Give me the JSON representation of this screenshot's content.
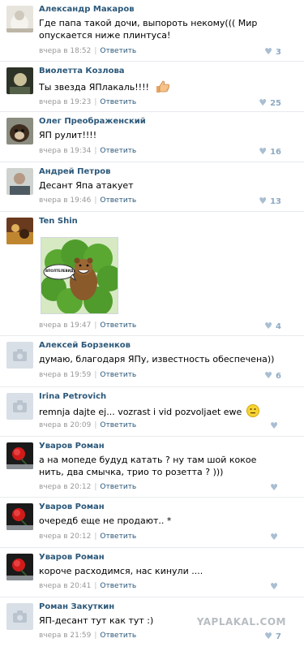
{
  "comments": [
    {
      "author": "Александр Макаров",
      "text": "Где папа такой дочи, выпороть некому((( Мир опускается ниже плинтуса!",
      "time": "вчера в 18:52",
      "reply": "Ответить",
      "likes": "3"
    },
    {
      "author": "Виолетта Козлова",
      "text": "Ты звезда ЯПлакаль!!!!",
      "time": "вчера в 19:23",
      "reply": "Ответить",
      "likes": "25"
    },
    {
      "author": "Олег Преображенский",
      "text": "ЯП рулит!!!!",
      "time": "вчера в 19:34",
      "reply": "Ответить",
      "likes": "16"
    },
    {
      "author": "Андрей Петров",
      "text": "Десант Япа атакует",
      "time": "вчера в 19:46",
      "reply": "Ответить",
      "likes": "13"
    },
    {
      "author": "Ten Shin",
      "text": "",
      "time": "вчера в 19:47",
      "reply": "Ответить",
      "likes": "4"
    },
    {
      "author": "Алексей Борзенков",
      "text": "думаю, благодаря ЯПу, известность обеспечена))",
      "time": "вчера в 19:59",
      "reply": "Ответить",
      "likes": "6"
    },
    {
      "author": "Irina Petrovich",
      "text": "remnja dajte ej... vozrast i vid pozvoljaet ewe",
      "time": "вчера в 20:09",
      "reply": "Ответить",
      "likes": ""
    },
    {
      "author": "Уваров Роман",
      "text": "а на мопеде будуд катать ? ну там шой кокое нить, два смычка, трио то розетта ? )))",
      "time": "вчера в 20:12",
      "reply": "Ответить",
      "likes": ""
    },
    {
      "author": "Уваров Роман",
      "text": "очередб еще не продают.. *",
      "time": "вчера в 20:12",
      "reply": "Ответить",
      "likes": ""
    },
    {
      "author": "Уваров Роман",
      "text": "короче расходимся, нас кинули ....",
      "time": "вчера в 20:41",
      "reply": "Ответить",
      "likes": ""
    },
    {
      "author": "Роман Закуткин",
      "text": "ЯП-десант тут как тут :)",
      "time": "вчера в 21:59",
      "reply": "Ответить",
      "likes": "7"
    }
  ],
  "meme_bubble": "ВПОЛТЕЛЕВИДЕЕ",
  "watermark": "YAPLAKAL.COM",
  "icons": {
    "like": "heart-icon",
    "no_photo": "camera-icon",
    "thumb": "thumbs-up-icon",
    "smile": "smiley-icon"
  },
  "colors": {
    "link": "#2b587a",
    "meta": "#999999",
    "likes": "#8eaac4",
    "divider": "#e7eaed"
  }
}
